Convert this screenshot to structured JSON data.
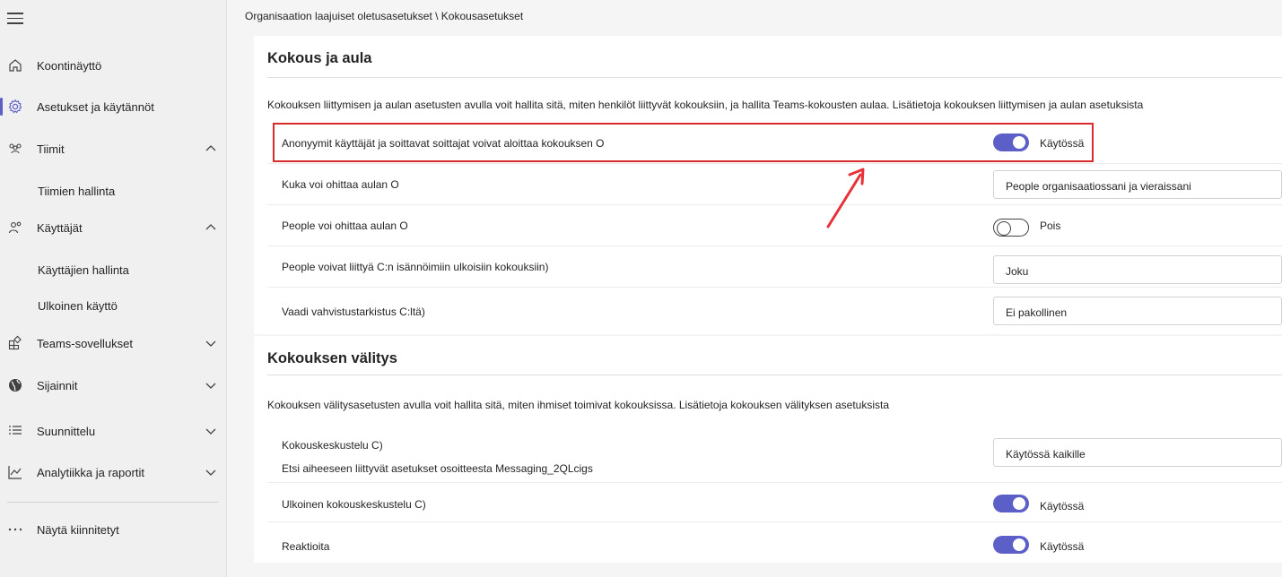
{
  "breadcrumb": "Organisaation laajuiset oletusasetukset \\ Kokousasetukset",
  "sidebar": {
    "items": [
      {
        "label": "Koontinäyttö",
        "icon": "home-icon"
      },
      {
        "label": "Asetukset ja käytännöt",
        "icon": "gear-icon"
      },
      {
        "label": "Tiimit",
        "icon": "teams-icon"
      },
      {
        "label": "Tiimien hallinta"
      },
      {
        "label": "Käyttäjät",
        "icon": "users-icon"
      },
      {
        "label": "Käyttäjien hallinta"
      },
      {
        "label": "Ulkoinen käyttö"
      },
      {
        "label": "Teams-sovellukset",
        "icon": "apps-icon"
      },
      {
        "label": "Sijainnit",
        "icon": "globe-icon"
      },
      {
        "label": "Suunnittelu",
        "icon": "list-icon"
      },
      {
        "label": "Analytiikka ja raportit",
        "icon": "chart-icon"
      },
      {
        "label": "Näytä kiinnitetyt",
        "icon": "more-icon"
      }
    ]
  },
  "section1": {
    "title": "Kokous ja aula",
    "description": "Kokouksen liittymisen ja aulan asetusten avulla voit hallita sitä, miten henkilöt liittyvät kokouksiin, ja hallita Teams-kokousten aulaa. Lisätietoja kokouksen liittymisen ja aulan asetuksista",
    "rows": [
      {
        "label": "Anonyymit käyttäjät ja soittavat soittajat voivat aloittaa kokouksen O",
        "value": "Käytössä"
      },
      {
        "label": "Kuka voi ohittaa aulan O",
        "value": "People organisaatiossani ja vieraissani"
      },
      {
        "label": "People voi ohittaa aulan O",
        "value": "Pois"
      },
      {
        "label": "People voivat liittyä C:n isännöimiin ulkoisiin kokouksiin)",
        "value": "Joku"
      },
      {
        "label": "Vaadi vahvistustarkistus C:ltä)",
        "value": "Ei pakollinen"
      }
    ]
  },
  "section2": {
    "title": "Kokouksen välitys",
    "description": "Kokouksen välitysasetusten avulla voit hallita sitä, miten ihmiset toimivat kokouksissa. Lisätietoja kokouksen välityksen asetuksista",
    "rows": [
      {
        "label": "Kokouskeskustelu C)",
        "sub": "Etsi aiheeseen liittyvät asetukset osoitteesta Messaging_2QLcigs",
        "value": "Käytössä kaikille"
      },
      {
        "label": "Ulkoinen kokouskeskustelu C)",
        "value": "Käytössä"
      },
      {
        "label": "Reaktioita",
        "value": "Käytössä"
      }
    ]
  },
  "colors": {
    "accent": "#5b5fc7",
    "highlight": "#d92b2b"
  }
}
